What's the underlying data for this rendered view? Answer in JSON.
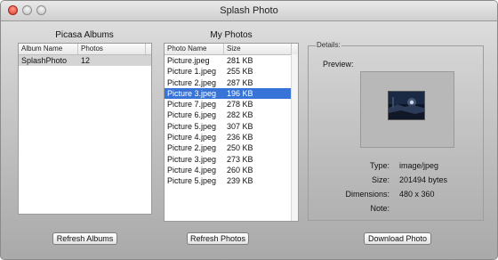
{
  "window": {
    "title": "Splash Photo"
  },
  "albums": {
    "title": "Picasa Albums",
    "columns": [
      "Album Name",
      "Photos"
    ],
    "rows": [
      {
        "name": "SplashPhoto",
        "photos": "12"
      }
    ],
    "refresh_label": "Refresh Albums"
  },
  "photos": {
    "title": "My Photos",
    "columns": [
      "Photo Name",
      "Size"
    ],
    "rows": [
      {
        "name": "Picture.jpeg",
        "size": "281 KB"
      },
      {
        "name": "Picture 1.jpeg",
        "size": "255 KB"
      },
      {
        "name": "Picture 2.jpeg",
        "size": "287 KB"
      },
      {
        "name": "Picture 3.jpeg",
        "size": "196 KB"
      },
      {
        "name": "Picture 7.jpeg",
        "size": "278 KB"
      },
      {
        "name": "Picture 6.jpeg",
        "size": "282 KB"
      },
      {
        "name": "Picture 5.jpeg",
        "size": "307 KB"
      },
      {
        "name": "Picture 4.jpeg",
        "size": "236 KB"
      },
      {
        "name": "Picture 2.jpeg",
        "size": "250 KB"
      },
      {
        "name": "Picture 3.jpeg",
        "size": "273 KB"
      },
      {
        "name": "Picture 4.jpeg",
        "size": "260 KB"
      },
      {
        "name": "Picture 5.jpeg",
        "size": "239 KB"
      }
    ],
    "selected_index": 3,
    "refresh_label": "Refresh Photos"
  },
  "details": {
    "legend": "Details:",
    "preview_label": "Preview:",
    "type_label": "Type:",
    "type_value": "image/jpeg",
    "size_label": "Size:",
    "size_value": "201494 bytes",
    "dimensions_label": "Dimensions:",
    "dimensions_value": "480 x 360",
    "note_label": "Note:",
    "note_value": "",
    "download_label": "Download Photo"
  },
  "colors": {
    "selection": "#3874d8",
    "window_top": "#e4e4e4",
    "window_bottom": "#a9a9a9"
  }
}
